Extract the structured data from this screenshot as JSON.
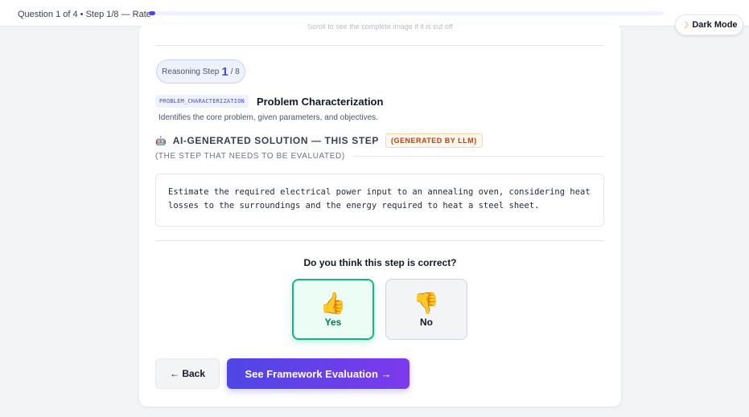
{
  "header": {
    "progress_label": "Question 1 of 4 • Step 1/8 — Rate",
    "progress_fraction": 0.0125,
    "dark_mode_label": "Dark Mode",
    "dark_mode_icon": "moon-icon"
  },
  "card": {
    "faded_hint": "Scroll to see the complete image if it is cut off",
    "pill": {
      "prefix": "Reasoning Step",
      "current": "1",
      "total": "/ 8"
    },
    "step": {
      "code": "PROBLEM_CHARACTERIZATION",
      "title": "Problem Characterization",
      "description": "Identifies the core problem, given parameters, and objectives."
    },
    "solution": {
      "icon": "robot-icon",
      "title": "AI-GENERATED SOLUTION — THIS STEP",
      "badge": "(GENERATED BY LLM)",
      "subtitle": "(THE STEP THAT NEEDS TO BE EVALUATED)",
      "line1": "Estimate the required electrical power input to an annealing oven, considering heat",
      "line2": "losses to the surroundings and the energy required to heat a steel sheet."
    },
    "question": "Do you think this step is correct?",
    "votes": {
      "yes": {
        "emoji": "👍",
        "label": "Yes"
      },
      "no": {
        "emoji": "👎",
        "label": "No"
      }
    },
    "back_label": "← Back",
    "next_label": "See Framework Evaluation →"
  },
  "colors": {
    "accent": "#4f46e5",
    "yes_green": "#10b981",
    "badge_orange": "#c2410c"
  }
}
